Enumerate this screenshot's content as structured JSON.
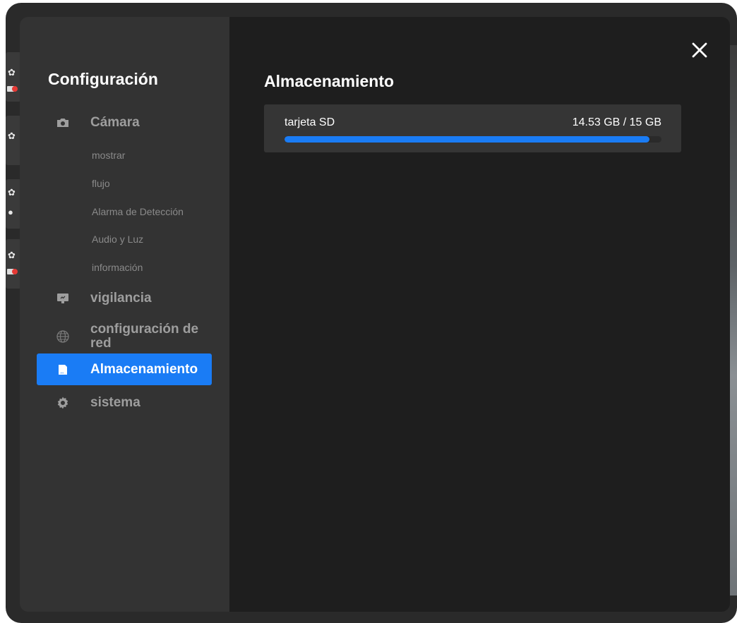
{
  "sidebar": {
    "title": "Configuración",
    "camera": {
      "label": "Cámara",
      "icon": "camera-icon",
      "subitems": [
        "mostrar",
        "flujo",
        "Alarma de Detección",
        "Audio y Luz",
        "información"
      ]
    },
    "items": [
      {
        "label": "vigilancia",
        "icon": "monitor-icon"
      },
      {
        "label": "configuración de red",
        "icon": "globe-icon"
      },
      {
        "label": "Almacenamiento",
        "icon": "sd-card-icon",
        "active": true
      },
      {
        "label": "sistema",
        "icon": "gear-icon"
      }
    ]
  },
  "main": {
    "title": "Almacenamiento",
    "storage": {
      "name": "tarjeta SD",
      "usage_text": "14.53 GB / 15 GB",
      "used_gb": 14.53,
      "total_gb": 15
    }
  },
  "close_icon": "close-icon",
  "colors": {
    "accent": "#1a7cf5",
    "sidebar_bg": "#333333",
    "main_bg": "#1e1e1e",
    "card_bg": "#353535"
  }
}
